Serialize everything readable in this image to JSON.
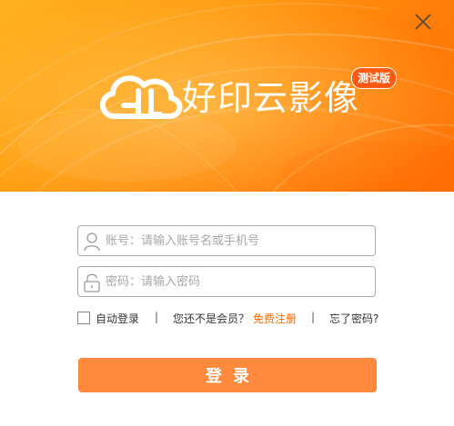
{
  "window": {
    "brand_name": "好印云影像",
    "badge": "测试版",
    "accent_color": "#ff8a3d",
    "banner_color": "#ff9a12"
  },
  "account_field": {
    "icon": "user-icon",
    "value": "",
    "placeholder": "账号：请输入账号名或手机号"
  },
  "password_field": {
    "icon": "lock-icon",
    "value": "",
    "placeholder": "密码：请输入密码"
  },
  "options": {
    "auto_login_label": "自动登录",
    "separator": "|",
    "not_member_text": "您还不是会员？",
    "register_link": "免费注册",
    "forgot_password": "忘了密码?"
  },
  "login_button": {
    "label": "登录"
  }
}
